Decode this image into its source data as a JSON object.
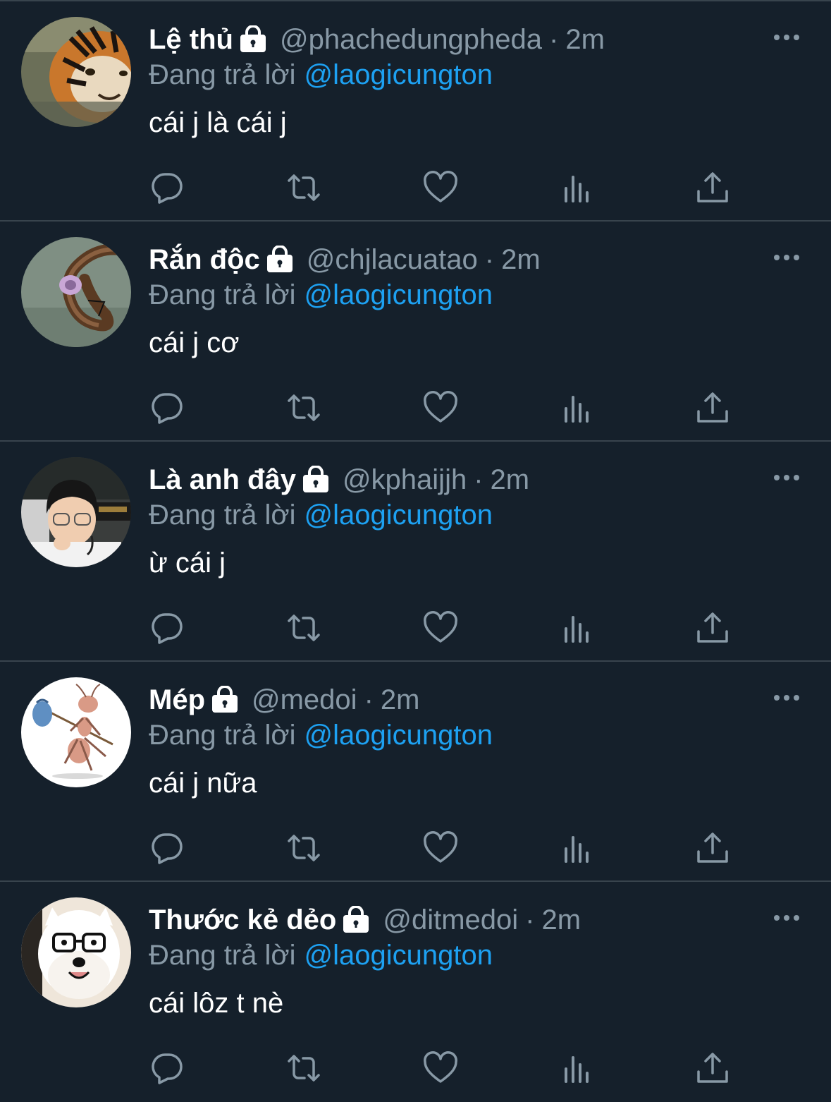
{
  "reply_prefix": "Đang trả lời",
  "colors": {
    "background": "#15202b",
    "divider": "#38444d",
    "secondary_text": "#8899a6",
    "mention": "#1da1f2",
    "primary_text": "#ffffff"
  },
  "tweets": [
    {
      "display_name": "Lệ thủ",
      "handle": "@phachedungpheda",
      "separator": "·",
      "time": "2m",
      "reply_to": "@laogicungton",
      "text": "cái j là cái j",
      "avatar_icon": "tiger-avatar",
      "protected_icon": "lock-icon"
    },
    {
      "display_name": "Rắn độc",
      "handle": "@chjlacuatao",
      "separator": "·",
      "time": "2m",
      "reply_to": "@laogicungton",
      "text": "cái j cơ",
      "avatar_icon": "snake-avatar",
      "protected_icon": "lock-icon"
    },
    {
      "display_name": "Là anh đây",
      "handle": "@kphaijjh",
      "separator": "·",
      "time": "2m",
      "reply_to": "@laogicungton",
      "text": "ừ cái j",
      "avatar_icon": "person-avatar",
      "protected_icon": "lock-icon"
    },
    {
      "display_name": "Mép",
      "handle": "@medoi",
      "separator": "·",
      "time": "2m",
      "reply_to": "@laogicungton",
      "text": "cái j nữa",
      "avatar_icon": "ant-avatar",
      "protected_icon": "lock-icon"
    },
    {
      "display_name": "Thước kẻ dẻo",
      "handle": "@ditmedoi",
      "separator": "·",
      "time": "2m",
      "reply_to": "@laogicungton",
      "text": "cái lôz t nè",
      "avatar_icon": "dog-avatar",
      "protected_icon": "lock-icon"
    }
  ],
  "action_icons": [
    "reply-icon",
    "retweet-icon",
    "like-icon",
    "analytics-icon",
    "share-icon"
  ],
  "more_icon": "more-options-icon"
}
